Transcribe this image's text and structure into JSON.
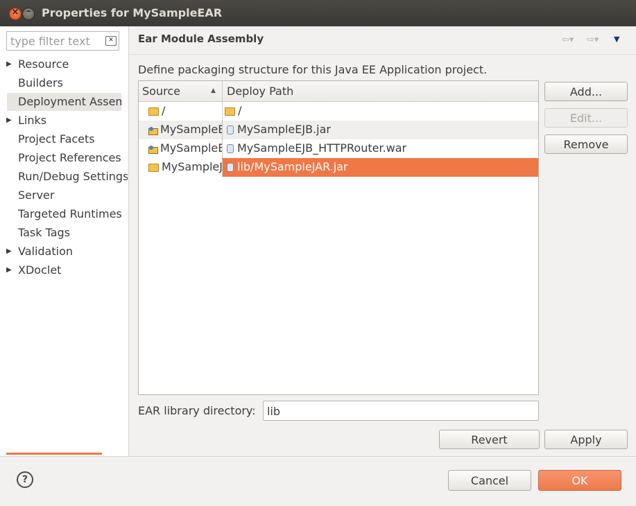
{
  "window": {
    "title": "Properties for MySampleEAR"
  },
  "sidebar": {
    "filter_placeholder": "type filter text",
    "items": [
      {
        "label": "Resource",
        "expandable": true
      },
      {
        "label": "Builders",
        "expandable": false
      },
      {
        "label": "Deployment Assembly",
        "expandable": false,
        "selected": true
      },
      {
        "label": "Links",
        "expandable": true
      },
      {
        "label": "Project Facets",
        "expandable": false
      },
      {
        "label": "Project References",
        "expandable": false
      },
      {
        "label": "Run/Debug Settings",
        "expandable": false
      },
      {
        "label": "Server",
        "expandable": false
      },
      {
        "label": "Targeted Runtimes",
        "expandable": false
      },
      {
        "label": "Task Tags",
        "expandable": false
      },
      {
        "label": "Validation",
        "expandable": true
      },
      {
        "label": "XDoclet",
        "expandable": true
      }
    ]
  },
  "page": {
    "title": "Ear Module Assembly",
    "description": "Define packaging structure for this Java EE Application project."
  },
  "table": {
    "columns": [
      "Source",
      "Deploy Path"
    ],
    "rows": [
      {
        "source": "/",
        "deploy": "/"
      },
      {
        "source": "MySampleEJB",
        "deploy": "MySampleEJB.jar"
      },
      {
        "source": "MySampleEJB_HTTPRouter",
        "deploy": "MySampleEJB_HTTPRouter.war"
      },
      {
        "source": "MySampleJAR",
        "deploy": "lib/MySampleJAR.jar",
        "selected": true
      }
    ]
  },
  "buttons": {
    "add": "Add...",
    "edit": "Edit...",
    "remove": "Remove",
    "revert": "Revert",
    "apply": "Apply",
    "cancel": "Cancel",
    "ok": "OK"
  },
  "ear_library": {
    "label": "EAR library directory:",
    "value": "lib"
  },
  "colors": {
    "accent": "#f07746",
    "titlebar": "#3c3b37"
  }
}
